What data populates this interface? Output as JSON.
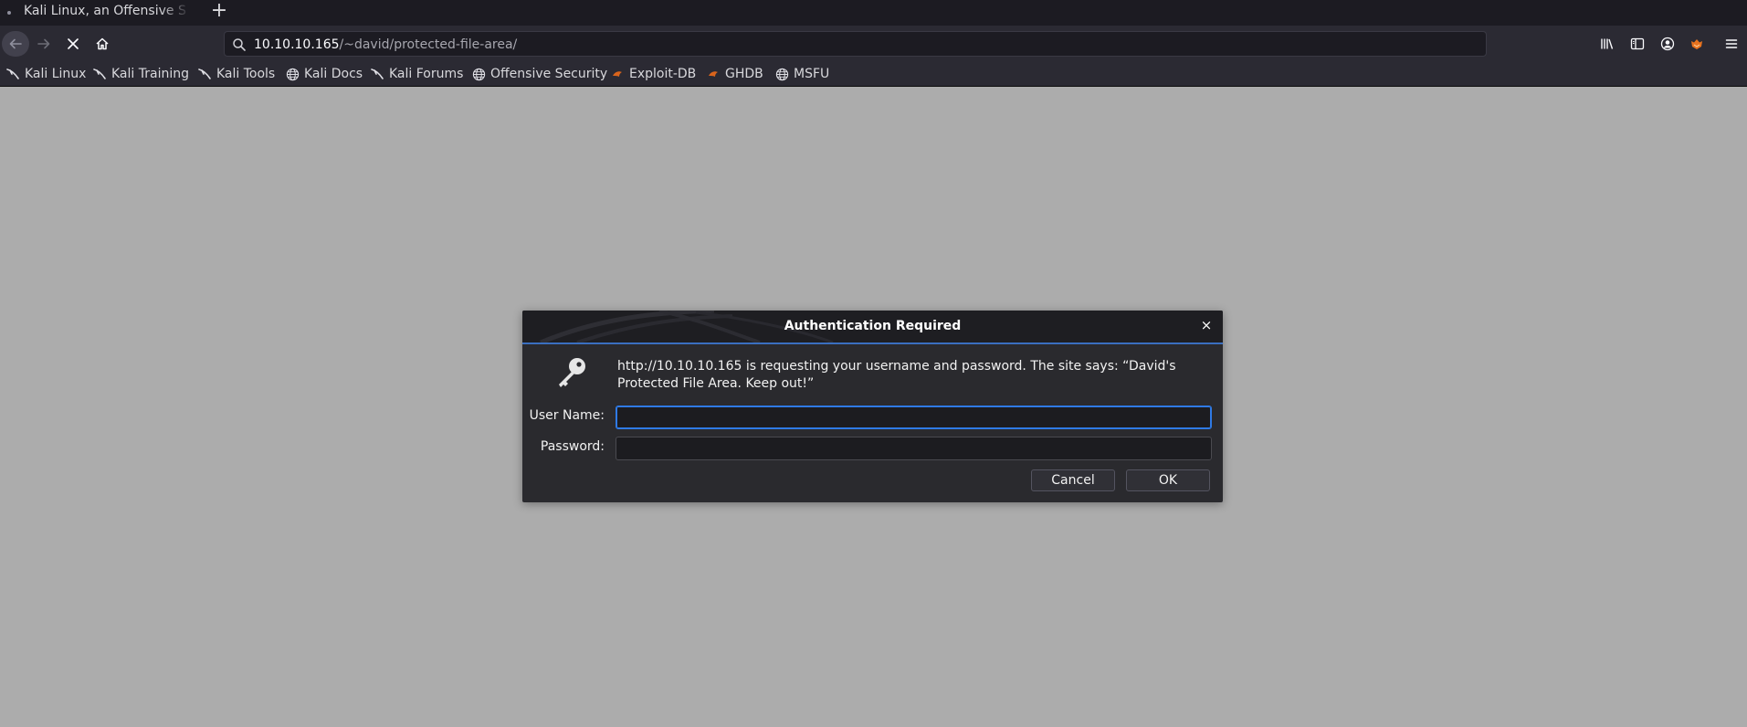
{
  "tabs": [
    {
      "title": "Kali Linux, an Offensive S"
    }
  ],
  "new_tab_label": "+",
  "urlbar": {
    "host": "10.10.10.165",
    "path": "/~david/protected-file-area/"
  },
  "navbar": {
    "back_icon": "arrow-left-icon",
    "forward_icon": "arrow-right-icon",
    "stop_icon": "close-icon",
    "home_icon": "home-icon"
  },
  "bookmarks": [
    {
      "label": "Kali Linux",
      "icon": "kali-dragon-icon"
    },
    {
      "label": "Kali Training",
      "icon": "kali-dragon-icon"
    },
    {
      "label": "Kali Tools",
      "icon": "kali-dragon-icon"
    },
    {
      "label": "Kali Docs",
      "icon": "globe-icon"
    },
    {
      "label": "Kali Forums",
      "icon": "kali-dragon-icon"
    },
    {
      "label": "Offensive Security",
      "icon": "globe-icon"
    },
    {
      "label": "Exploit-DB",
      "icon": "exploitdb-icon"
    },
    {
      "label": "GHDB",
      "icon": "exploitdb-icon"
    },
    {
      "label": "MSFU",
      "icon": "globe-icon"
    }
  ],
  "dialog": {
    "title": "Authentication Required",
    "close_label": "×",
    "message": "http://10.10.10.165 is requesting your username and password. The site says: “David's Protected File Area. Keep out!”",
    "username_label": "User Name:",
    "password_label": "Password:",
    "username_value": "",
    "password_value": "",
    "cancel_label": "Cancel",
    "ok_label": "OK"
  },
  "colors": {
    "page_background": "#acacac",
    "toolbar": "#2b2a33",
    "tabstrip": "#1c1b22",
    "dialog": "#2a2a2e",
    "focus_accent": "#2f7ae5"
  }
}
